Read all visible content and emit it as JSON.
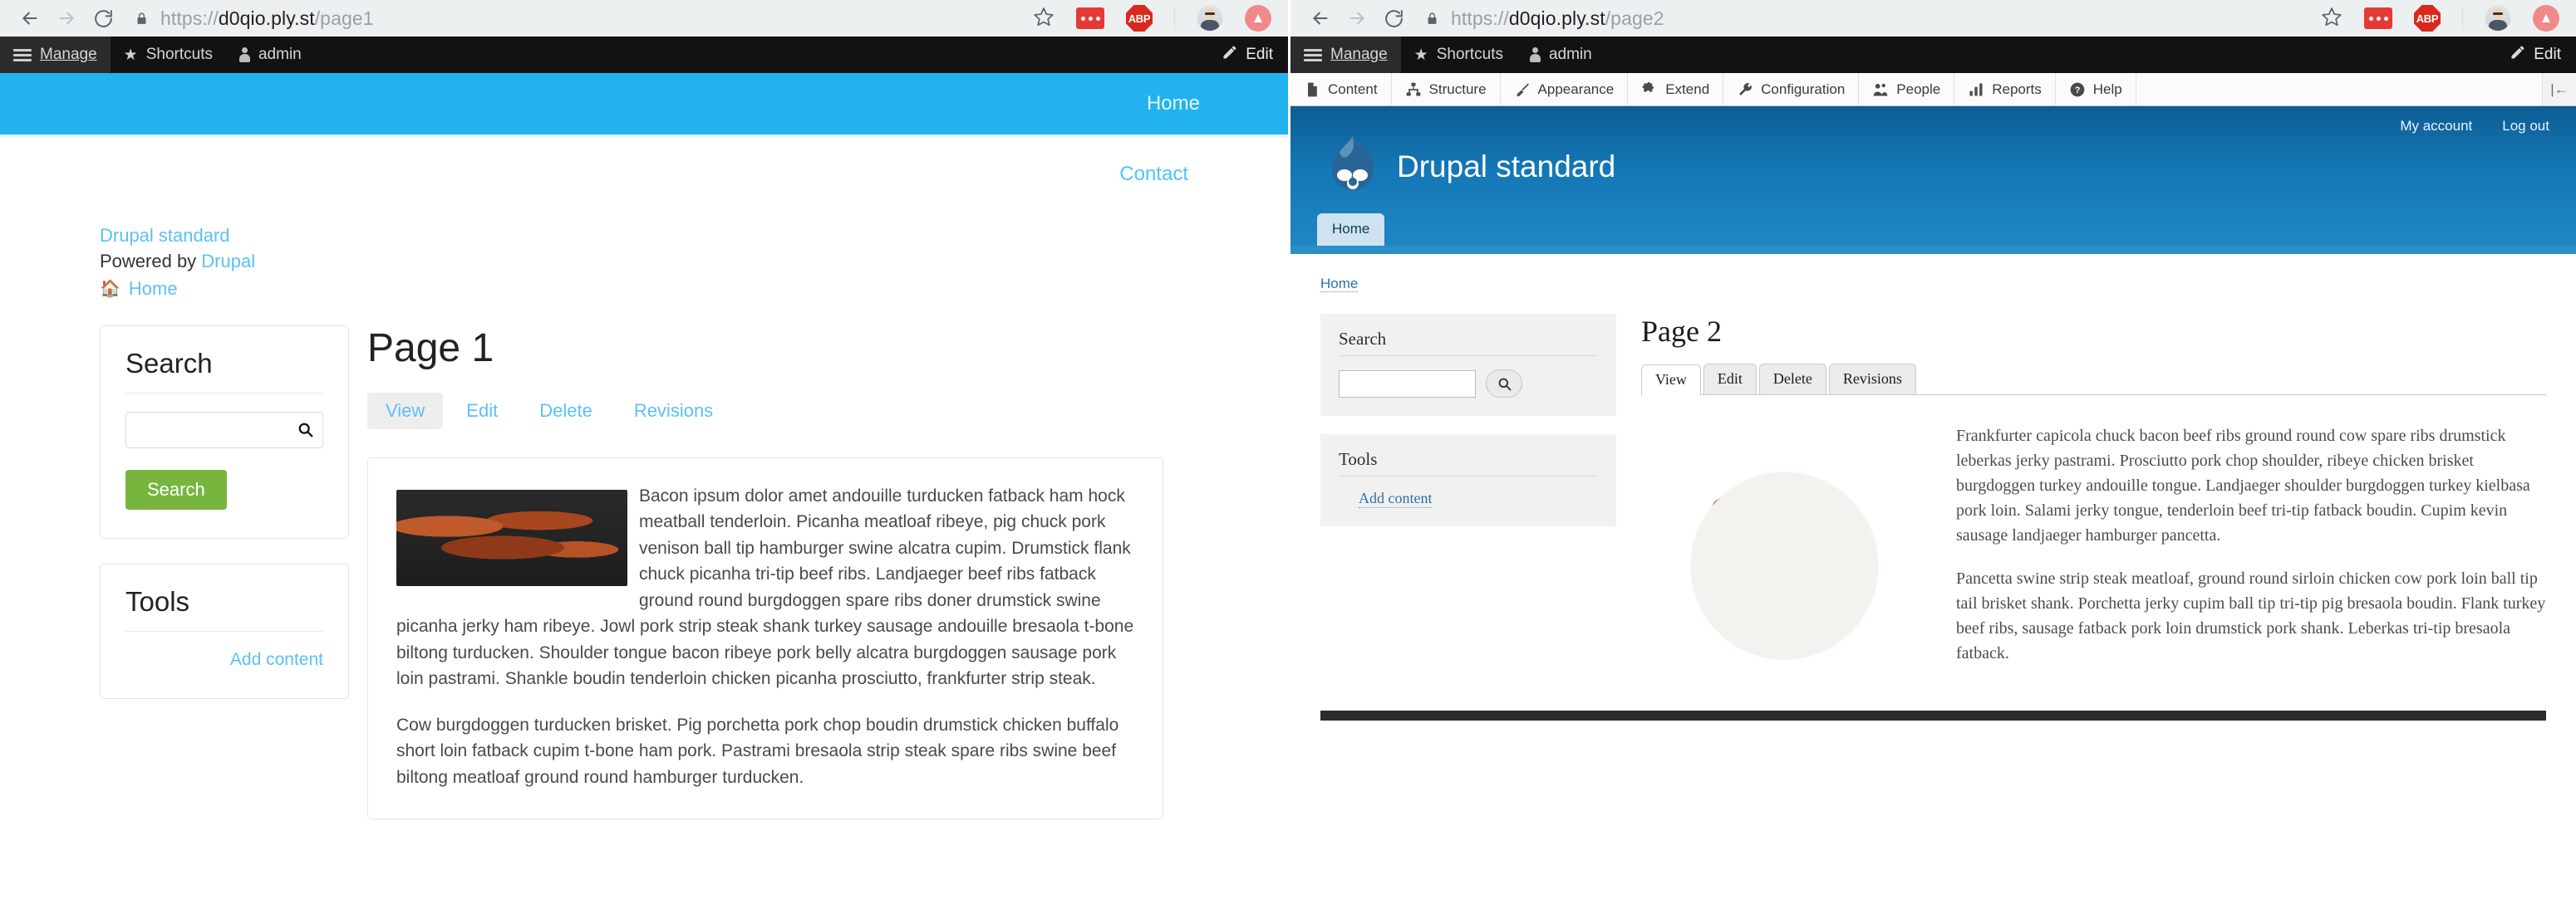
{
  "left_window": {
    "browser": {
      "back_icon": "back-arrow-icon",
      "forward_icon": "forward-arrow-icon",
      "reload_icon": "reload-icon",
      "lock_icon": "lock-icon",
      "url_scheme": "https://",
      "url_host": "d0qio.ply.st",
      "url_path": "/page1",
      "star_icon": "bookmark-star-icon",
      "extension_icon": "extension-red-icon",
      "adblock_label": "ABP",
      "profile_icon": "profile-avatar-icon",
      "upload_icon": "upload-circle-icon"
    },
    "admin_toolbar": {
      "menu_icon": "hamburger-menu-icon",
      "manage_label": "Manage",
      "shortcuts_icon": "star-icon",
      "shortcuts_label": "Shortcuts",
      "account_icon": "user-icon",
      "account_label": "admin",
      "edit_icon": "pencil-icon",
      "edit_label": "Edit"
    },
    "site": {
      "hero_home_label": "Home",
      "contact_label": "Contact",
      "site_name": "Drupal standard",
      "powered_prefix": "Powered by ",
      "powered_link": "Drupal",
      "home_icon": "home-icon",
      "breadcrumb_home": "Home",
      "search_block": {
        "title": "Search",
        "input_value": "",
        "input_placeholder": "",
        "magnifier_icon": "search-icon",
        "button_label": "Search"
      },
      "tools_block": {
        "title": "Tools",
        "add_content_label": "Add content"
      },
      "page_title": "Page 1",
      "tabs": [
        {
          "label": "View",
          "active": true
        },
        {
          "label": "Edit",
          "active": false
        },
        {
          "label": "Delete",
          "active": false
        },
        {
          "label": "Revisions",
          "active": false
        }
      ],
      "image_alt": "bacon-strips-on-slate-image",
      "paragraphs": [
        "Bacon ipsum dolor amet andouille turducken fatback ham hock meatball tenderloin. Picanha meatloaf ribeye, pig chuck pork venison ball tip hamburger swine alcatra cupim. Drumstick flank chuck picanha tri-tip beef ribs. Landjaeger beef ribs fatback ground round burgdoggen spare ribs doner drumstick swine picanha jerky ham ribeye. Jowl pork strip steak shank turkey sausage andouille bresaola t-bone biltong turducken. Shoulder tongue bacon ribeye pork belly alcatra burgdoggen sausage pork loin pastrami. Shankle boudin tenderloin chicken picanha prosciutto, frankfurter strip steak.",
        "Cow burgdoggen turducken brisket. Pig porchetta pork chop boudin drumstick chicken buffalo short loin fatback cupim t-bone ham pork. Pastrami bresaola strip steak spare ribs swine beef biltong meatloaf ground round hamburger turducken."
      ]
    }
  },
  "right_window": {
    "browser": {
      "back_icon": "back-arrow-icon",
      "forward_icon": "forward-arrow-icon",
      "reload_icon": "reload-icon",
      "lock_icon": "lock-icon",
      "url_scheme": "https://",
      "url_host": "d0qio.ply.st",
      "url_path": "/page2",
      "star_icon": "bookmark-star-icon",
      "extension_icon": "extension-red-icon",
      "adblock_label": "ABP",
      "profile_icon": "profile-avatar-icon",
      "upload_icon": "upload-circle-icon"
    },
    "admin_toolbar": {
      "menu_icon": "hamburger-menu-icon",
      "manage_label": "Manage",
      "shortcuts_icon": "star-icon",
      "shortcuts_label": "Shortcuts",
      "account_icon": "user-icon",
      "account_label": "admin",
      "edit_icon": "pencil-icon",
      "edit_label": "Edit"
    },
    "admin_menu": [
      {
        "label": "Content",
        "icon": "document-icon"
      },
      {
        "label": "Structure",
        "icon": "sitemap-icon"
      },
      {
        "label": "Appearance",
        "icon": "paintbrush-icon"
      },
      {
        "label": "Extend",
        "icon": "puzzle-piece-icon"
      },
      {
        "label": "Configuration",
        "icon": "wrench-icon"
      },
      {
        "label": "People",
        "icon": "people-icon"
      },
      {
        "label": "Reports",
        "icon": "bar-chart-icon"
      },
      {
        "label": "Help",
        "icon": "question-mark-icon"
      }
    ],
    "collapse_icon": "collapse-toolbar-icon",
    "site": {
      "my_account_label": "My account",
      "log_out_label": "Log out",
      "logo_icon": "drupal-droplet-logo",
      "site_name": "Drupal standard",
      "home_tab_label": "Home",
      "breadcrumb_home": "Home",
      "search_block": {
        "title": "Search",
        "input_value": "",
        "input_placeholder": "",
        "magnifier_icon": "search-icon"
      },
      "tools_block": {
        "title": "Tools",
        "add_content_label": "Add content"
      },
      "page_title": "Page 2",
      "tabs": [
        {
          "label": "View",
          "active": true
        },
        {
          "label": "Edit",
          "active": false
        },
        {
          "label": "Delete",
          "active": false
        },
        {
          "label": "Revisions",
          "active": false
        }
      ],
      "image_alt": "bacon-strips-on-plate-image",
      "paragraphs": [
        "Frankfurter capicola chuck bacon beef ribs ground round cow spare ribs drumstick leberkas jerky pastrami. Prosciutto pork chop shoulder, ribeye chicken brisket burgdoggen turkey andouille tongue. Landjaeger shoulder burgdoggen turkey kielbasa pork loin. Salami jerky tongue, tenderloin beef tri-tip fatback boudin. Cupim kevin sausage landjaeger hamburger pancetta.",
        "Pancetta swine strip steak meatloaf, ground round sirloin chicken cow pork loin ball tip tail brisket shank. Porchetta jerky cupim ball tip tri-tip pig bresaola boudin. Flank turkey beef ribs, sausage fatback pork loin drumstick pork shank. Leberkas tri-tip bresaola fatback."
      ]
    }
  },
  "colors": {
    "left_hero": "#22b3ef",
    "left_link": "#5bc0f8",
    "left_search_button": "#77b53e",
    "right_header_blue": "#1577b5",
    "right_link": "#2c6fad",
    "toolbar_dark": "#121212"
  }
}
